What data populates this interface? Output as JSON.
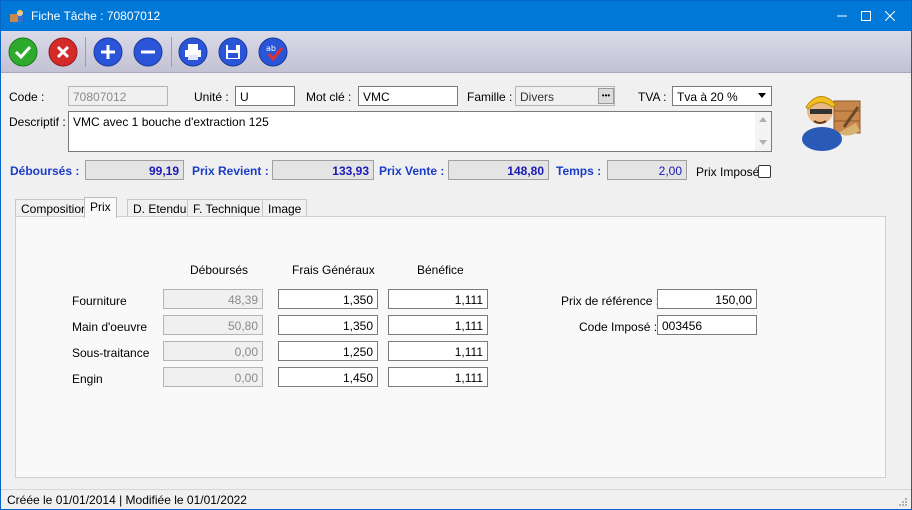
{
  "window": {
    "title": "Fiche Tâche : 70807012",
    "controls": {
      "minimize": "—",
      "maximize": "☐",
      "close": "✕"
    }
  },
  "toolbar": {
    "buttons": [
      {
        "name": "validate-icon",
        "color": "#2eaa2e"
      },
      {
        "name": "cancel-icon",
        "color": "#d42a2a"
      },
      {
        "name": "add-icon",
        "color": "#2a55d8"
      },
      {
        "name": "remove-icon",
        "color": "#2a55d8"
      },
      {
        "name": "print-icon",
        "color": "#2a55d8"
      },
      {
        "name": "save-icon",
        "color": "#2a55d8"
      },
      {
        "name": "spellcheck-icon",
        "color": "#2a55d8"
      }
    ]
  },
  "header": {
    "code_label": "Code :",
    "code_value": "70807012",
    "unite_label": "Unité :",
    "unite_value": "U",
    "motcle_label": "Mot clé :",
    "motcle_value": "VMC",
    "famille_label": "Famille :",
    "famille_value": "Divers",
    "famille_button": "•••",
    "tva_label": "TVA :",
    "tva_value": "Tva à 20 %",
    "descriptif_label": "Descriptif :",
    "descriptif_value": "VMC avec 1 bouche d'extraction 125"
  },
  "summary": {
    "debourses_label": "Déboursés :",
    "debourses_value": "99,19",
    "prix_revient_label": "Prix Revient :",
    "prix_revient_value": "133,93",
    "prix_vente_label": "Prix Vente :",
    "prix_vente_value": "148,80",
    "temps_label": "Temps :",
    "temps_value": "2,00",
    "prix_impose_label": "Prix Imposé"
  },
  "tabs": [
    "Composition",
    "Prix",
    "D. Etendu",
    "F. Technique",
    "Image"
  ],
  "prix_tab": {
    "col_headers": [
      "Déboursés",
      "Frais Généraux",
      "Bénéfice"
    ],
    "rows": [
      {
        "label": "Fourniture",
        "debourses": "48,39",
        "frais": "1,350",
        "benefice": "1,111"
      },
      {
        "label": "Main d'oeuvre",
        "debourses": "50,80",
        "frais": "1,350",
        "benefice": "1,111"
      },
      {
        "label": "Sous-traitance",
        "debourses": "0,00",
        "frais": "1,250",
        "benefice": "1,111"
      },
      {
        "label": "Engin",
        "debourses": "0,00",
        "frais": "1,450",
        "benefice": "1,111"
      }
    ],
    "prix_reference_label": "Prix de référence :",
    "prix_reference_value": "150,00",
    "code_impose_label": "Code Imposé :",
    "code_impose_value": "003456"
  },
  "status": {
    "text": "Créée le 01/01/2014 | Modifiée le 01/01/2022"
  }
}
